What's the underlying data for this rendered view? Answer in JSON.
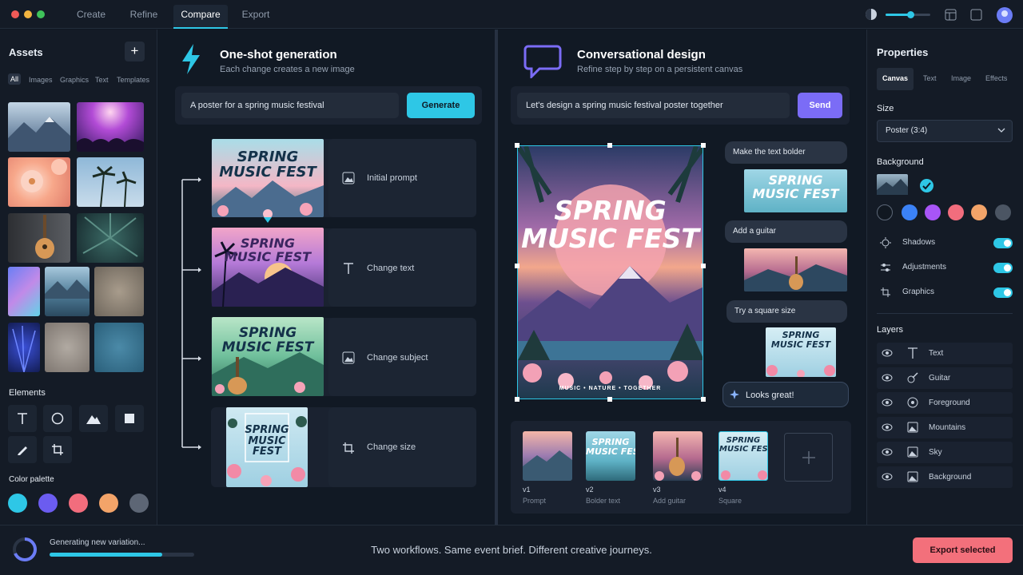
{
  "topbar": {
    "tabs": [
      "Create",
      "Refine",
      "Compare",
      "Export"
    ],
    "active_tab": "Compare",
    "zoom_level": 0.55
  },
  "assets": {
    "title": "Assets",
    "add_label": "+",
    "filters": [
      "All",
      "Images",
      "Graphics",
      "Text",
      "Templates"
    ],
    "elements_title": "Elements",
    "palette_title": "Color palette",
    "palette": [
      "#2ec7e6",
      "#6b5cf0",
      "#f26d7d",
      "#f3a469",
      "#5d6675"
    ]
  },
  "oneshot": {
    "title": "One-shot generation",
    "subtitle": "Each change creates a new image",
    "prompt_value": "A poster for a spring music festival",
    "generate_label": "Generate",
    "steps": [
      {
        "label": "Initial prompt",
        "icon": "image-icon",
        "poster": "SPRING\nMUSIC FEST"
      },
      {
        "label": "Change text",
        "icon": "text-icon",
        "poster": "SPRING\nMUSIC FEST"
      },
      {
        "label": "Change subject",
        "icon": "image-icon",
        "poster": "SPRING\nMUSIC FEST"
      },
      {
        "label": "Change size",
        "icon": "crop-icon",
        "poster": "SPRING\nMUSIC\nFEST"
      }
    ]
  },
  "conversation": {
    "title": "Conversational design",
    "subtitle": "Refine step by step on a persistent canvas",
    "prompt_value": "Let's design a spring music festival poster together",
    "send_label": "Send",
    "poster_title": "SPRING\nMUSIC FEST",
    "poster_tagline": "MUSIC  •  NATURE  •  TOGETHER",
    "messages": [
      "Make the text bolder",
      "Add a guitar",
      "Try a square size",
      "Looks great!"
    ],
    "versions": [
      {
        "id": "v1",
        "label": "Prompt"
      },
      {
        "id": "v2",
        "label": "Bolder text"
      },
      {
        "id": "v3",
        "label": "Add guitar"
      },
      {
        "id": "v4",
        "label": "Square"
      }
    ]
  },
  "properties": {
    "title": "Properties",
    "tabs": [
      "Canvas",
      "Text",
      "Image",
      "Effects"
    ],
    "active_tab": "Canvas",
    "size_title": "Size",
    "size_value": "Poster (3:4)",
    "background_title": "Background",
    "bg_swatches": [
      "#111821",
      "#3b82f6",
      "#a855f7",
      "#f26d7d",
      "#f3a469",
      "#4b5563"
    ],
    "toggles": [
      {
        "label": "Shadows",
        "on": true
      },
      {
        "label": "Adjustments",
        "on": true
      },
      {
        "label": "Graphics",
        "on": true
      }
    ],
    "layers_title": "Layers",
    "layers": [
      "Text",
      "Guitar",
      "Foreground",
      "Mountains",
      "Sky",
      "Background"
    ]
  },
  "footer": {
    "status": "Generating new variation...",
    "progress": 0.78,
    "tagline": "Two workflows. Same event brief. Different creative journeys.",
    "export_label": "Export selected"
  }
}
